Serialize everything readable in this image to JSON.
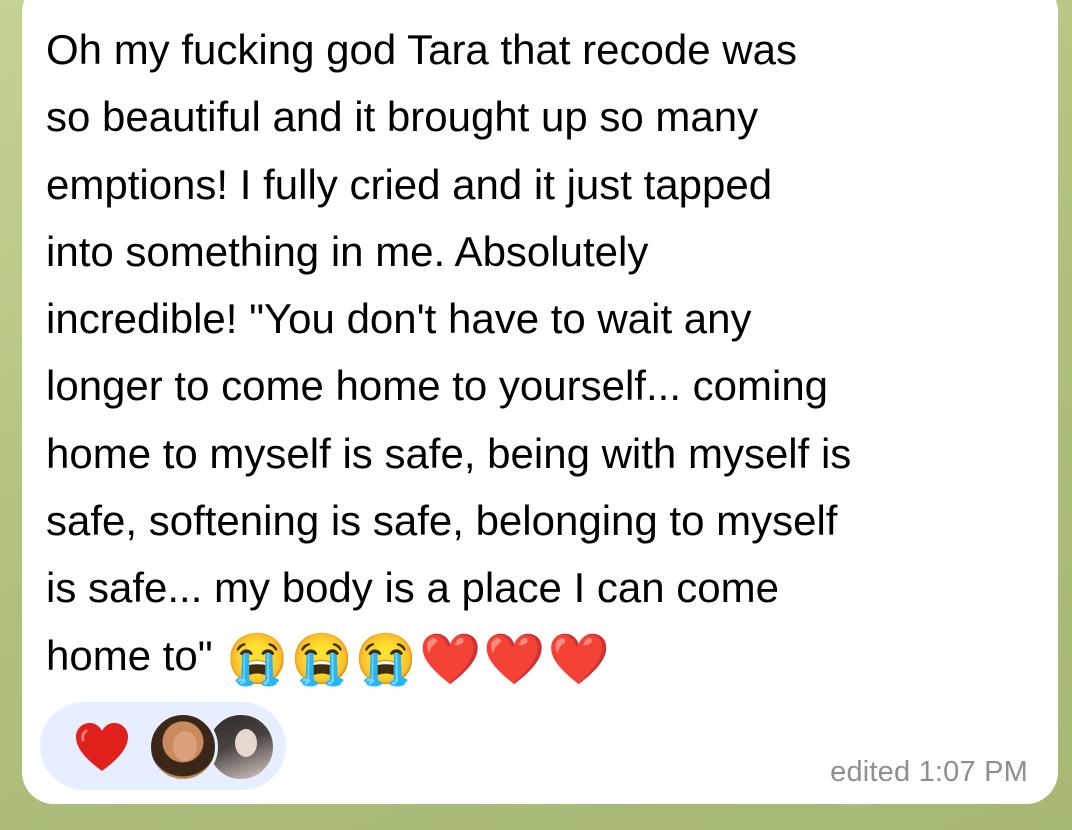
{
  "message": {
    "lines": [
      "Oh my fucking god Tara that recode was",
      "so beautiful and it brought up so many",
      "emptions! I fully cried and it just tapped",
      "into something in me. Absolutely",
      "incredible! \"You don't have to wait any",
      "longer to come home to yourself... coming",
      "home to myself is safe, being with myself is",
      "safe, softening is safe, belonging to myself",
      "is safe... my body is a place I can come"
    ],
    "last_line": "home to\" ",
    "emojis": [
      "😭",
      "😭",
      "😭",
      "❤️",
      "❤️",
      "❤️"
    ]
  },
  "reactions": {
    "emoji_icon": "red-heart-icon",
    "heart_color": "#e0201b",
    "pill_color": "#e6eeff",
    "avatars": [
      "avatar-user-1",
      "avatar-user-2"
    ]
  },
  "meta": {
    "timestamp": "edited 1:07 PM"
  },
  "colors": {
    "background": "#b7c98a",
    "bubble": "#ffffff",
    "text": "#000000",
    "timestamp": "#8e8e93"
  }
}
